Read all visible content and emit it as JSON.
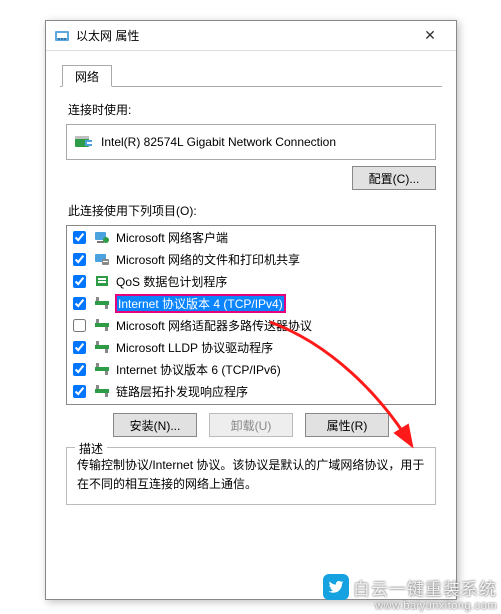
{
  "window": {
    "title": "以太网 属性",
    "close_glyph": "✕"
  },
  "tab": {
    "label": "网络"
  },
  "connect_using": {
    "label": "连接时使用:",
    "adapter": "Intel(R) 82574L Gigabit Network Connection",
    "configure_btn": "配置(C)..."
  },
  "items_label": "此连接使用下列项目(O):",
  "items": [
    {
      "checked": true,
      "label": "Microsoft 网络客户端",
      "icon": "client"
    },
    {
      "checked": true,
      "label": "Microsoft 网络的文件和打印机共享",
      "icon": "share"
    },
    {
      "checked": true,
      "label": "QoS 数据包计划程序",
      "icon": "qos"
    },
    {
      "checked": true,
      "label": "Internet 协议版本 4 (TCP/IPv4)",
      "icon": "proto",
      "selected": true
    },
    {
      "checked": false,
      "label": "Microsoft 网络适配器多路传送器协议",
      "icon": "proto"
    },
    {
      "checked": true,
      "label": "Microsoft LLDP 协议驱动程序",
      "icon": "proto"
    },
    {
      "checked": true,
      "label": "Internet 协议版本 6 (TCP/IPv6)",
      "icon": "proto"
    },
    {
      "checked": true,
      "label": "链路层拓扑发现响应程序",
      "icon": "proto"
    }
  ],
  "buttons": {
    "install": "安装(N)...",
    "uninstall": "卸载(U)",
    "props": "属性(R)"
  },
  "description": {
    "legend": "描述",
    "text": "传输控制协议/Internet 协议。该协议是默认的广域网络协议，用于在不同的相互连接的网络上通信。"
  },
  "brand": {
    "text": "白云一键重装系统",
    "url": "www.baiyunxitong.com"
  }
}
